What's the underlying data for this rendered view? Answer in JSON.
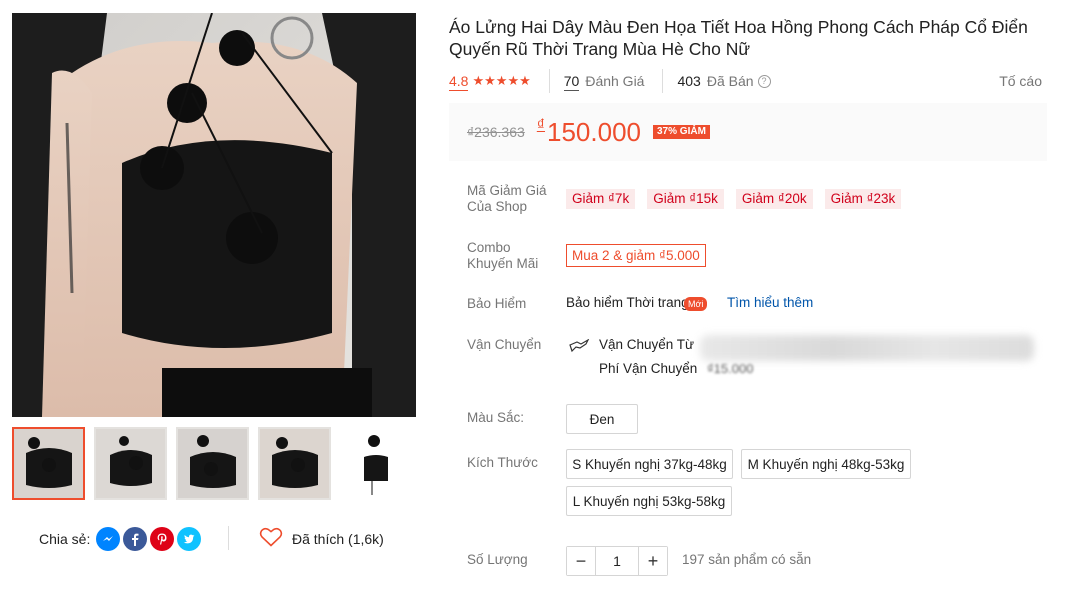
{
  "product": {
    "title": "Áo Lửng Hai Dây Màu Đen Họa Tiết Hoa Hồng Phong Cách Pháp Cổ Điển Quyến Rũ Thời Trang Mùa Hè Cho Nữ",
    "rating": "4.8",
    "stars": 5,
    "review_count": "70",
    "review_label": "Đánh Giá",
    "sold_count": "403",
    "sold_label": "Đã Bán",
    "report_label": "Tố cáo"
  },
  "price": {
    "old": "₫236.363",
    "currency": "₫",
    "current": "150.000",
    "discount": "37% GIẢM"
  },
  "vouchers": {
    "label": "Mã Giảm Giá Của Shop",
    "items": [
      "Giảm ₫7k",
      "Giảm ₫15k",
      "Giảm ₫20k",
      "Giảm ₫23k"
    ]
  },
  "combo": {
    "label": "Combo Khuyến Mãi",
    "text": "Mua 2 & giảm ₫5.000"
  },
  "insurance": {
    "label": "Bảo Hiểm",
    "name": "Bảo hiểm Thời trang",
    "badge": "Mới",
    "link": "Tìm hiểu thêm"
  },
  "shipping": {
    "label": "Vận Chuyển",
    "from_label": "Vận Chuyển Từ",
    "fee_label": "Phí Vận Chuyển",
    "fee_value": "₫15.000"
  },
  "color": {
    "label": "Màu Sắc:",
    "options": [
      "Đen"
    ]
  },
  "size": {
    "label": "Kích Thước",
    "options": [
      "S Khuyến nghị 37kg-48kg",
      "M Khuyến nghị 48kg-53kg",
      "L Khuyến nghị 53kg-58kg"
    ]
  },
  "quantity": {
    "label": "Số Lượng",
    "value": "1",
    "minus": "−",
    "plus": "+",
    "stock": "197 sản phẩm có sẵn"
  },
  "share": {
    "label": "Chia sẻ:",
    "icons": [
      "messenger-icon",
      "facebook-icon",
      "pinterest-icon",
      "twitter-icon"
    ],
    "liked": "Đã thích (1,6k)"
  },
  "colors": {
    "accent": "#ee4d2d",
    "voucher_bg": "#fbeaea",
    "link": "#0055aa",
    "messenger": "#0084ff",
    "facebook": "#3b5999",
    "pinterest": "#de0217",
    "twitter": "#10c2ff"
  }
}
